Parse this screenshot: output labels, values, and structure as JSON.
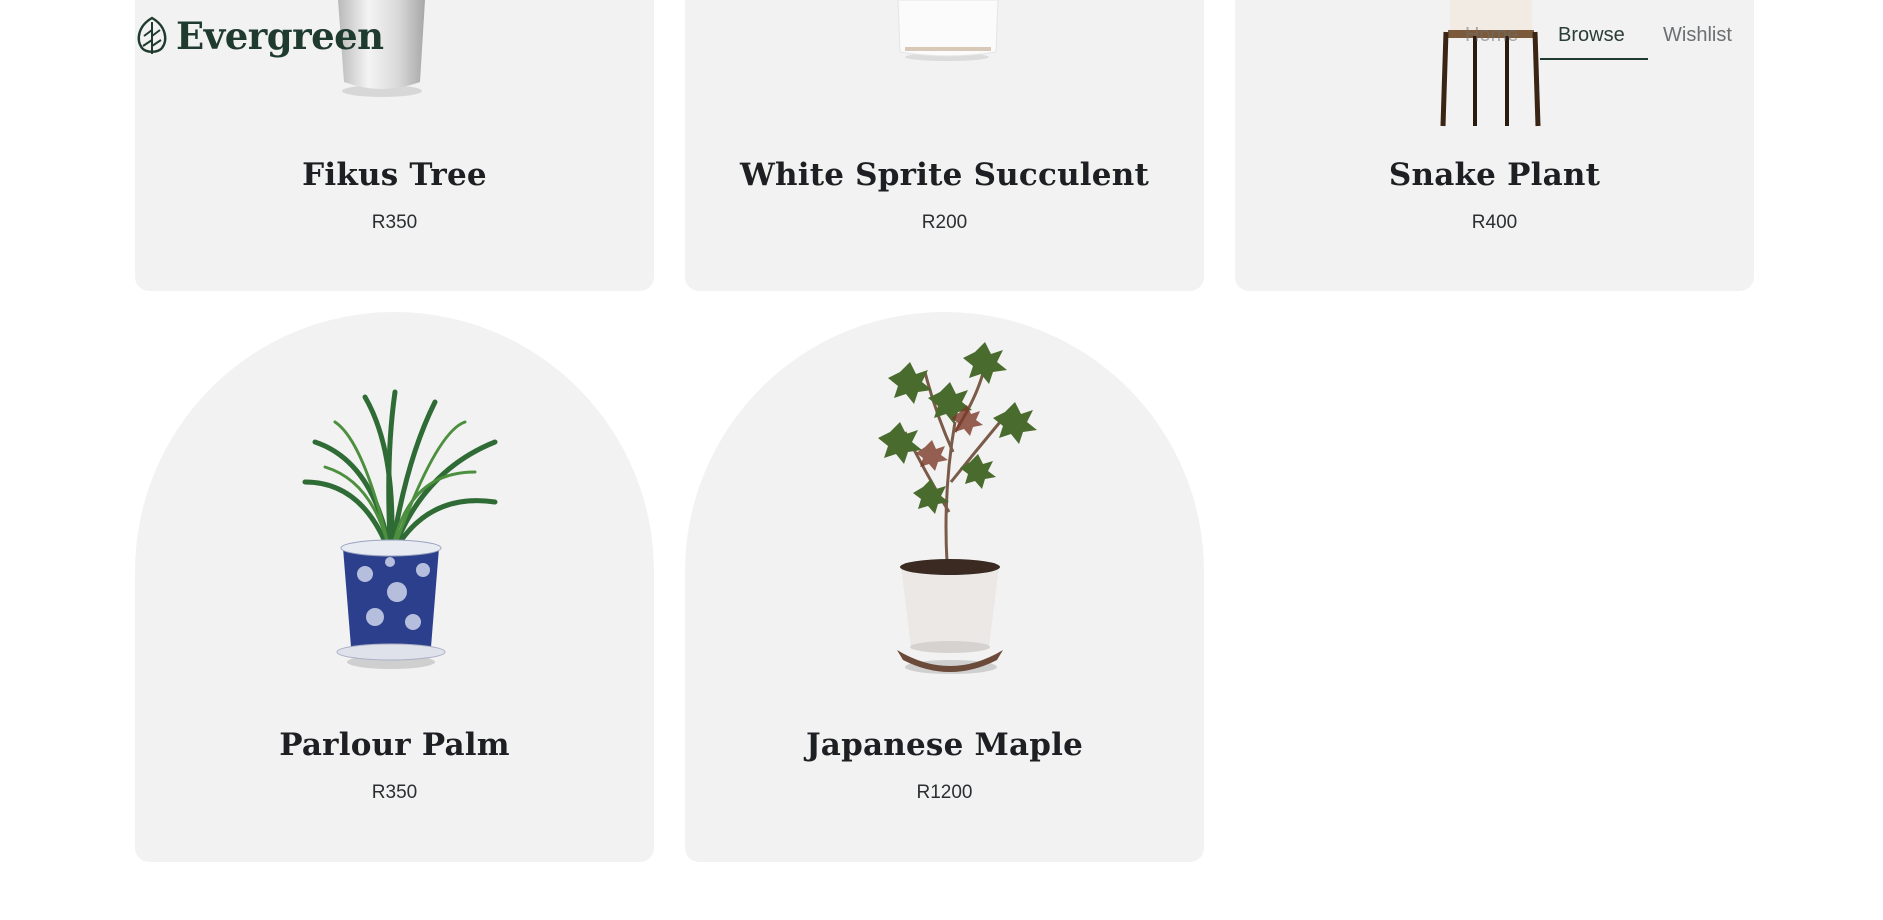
{
  "brand": {
    "name": "Evergreen",
    "icon": "leaf-icon"
  },
  "nav": {
    "items": [
      {
        "label": "Home",
        "active": false
      },
      {
        "label": "Browse",
        "active": true
      },
      {
        "label": "Wishlist",
        "active": false
      }
    ]
  },
  "products": [
    {
      "name": "Fikus Tree",
      "price": "R350"
    },
    {
      "name": "White Sprite Succulent",
      "price": "R200"
    },
    {
      "name": "Snake Plant",
      "price": "R400"
    },
    {
      "name": "Parlour Palm",
      "price": "R350"
    },
    {
      "name": "Japanese Maple",
      "price": "R1200"
    }
  ],
  "colors": {
    "brand": "#1f3a2f",
    "card_bg": "#f2f2f2",
    "text": "#1e1f22"
  }
}
